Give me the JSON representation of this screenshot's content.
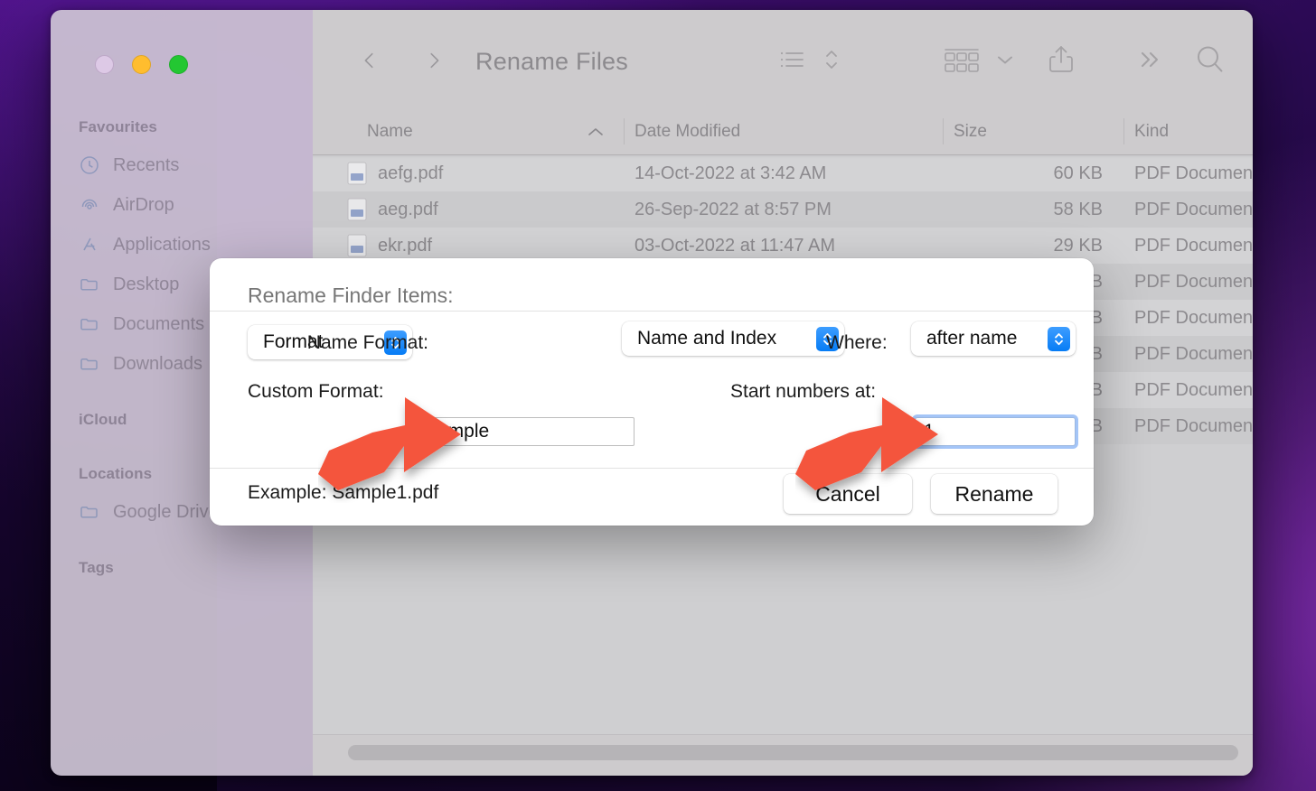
{
  "window": {
    "title": "Rename Files",
    "traffic_lights": [
      "close",
      "minimize",
      "maximize"
    ]
  },
  "toolbar": {
    "back_icon": "chevron-left-icon",
    "forward_icon": "chevron-right-icon",
    "list_view_icon": "list-view-icon",
    "sort_icon": "sort-updown-icon",
    "group_icon": "group-by-icon",
    "group_chevron_icon": "chevron-down-icon",
    "share_icon": "share-icon",
    "more_icon": "more-chevrons-icon",
    "search_icon": "search-icon"
  },
  "sidebar": {
    "sections": [
      {
        "heading": "Favourites",
        "items": [
          {
            "label": "Recents",
            "icon": "clock-icon"
          },
          {
            "label": "AirDrop",
            "icon": "airdrop-icon"
          },
          {
            "label": "Applications",
            "icon": "applications-icon"
          },
          {
            "label": "Desktop",
            "icon": "folder-icon"
          },
          {
            "label": "Documents",
            "icon": "folder-icon"
          },
          {
            "label": "Downloads",
            "icon": "folder-icon"
          }
        ]
      },
      {
        "heading": "iCloud",
        "items": []
      },
      {
        "heading": "Locations",
        "items": [
          {
            "label": "Google Drive",
            "icon": "folder-icon"
          }
        ]
      },
      {
        "heading": "Tags",
        "items": []
      }
    ]
  },
  "filelist": {
    "columns": [
      "Name",
      "Date Modified",
      "Size",
      "Kind"
    ],
    "sort_column": "Name",
    "sort_direction_icon": "chevron-up-icon",
    "rows": [
      {
        "name": "aefg.pdf",
        "date": "14-Oct-2022 at 3:42 AM",
        "size": "60 KB",
        "kind": "PDF Document"
      },
      {
        "name": "aeg.pdf",
        "date": "26-Sep-2022 at 8:57 PM",
        "size": "58 KB",
        "kind": "PDF Document"
      },
      {
        "name": "ekr.pdf",
        "date": "03-Oct-2022 at 11:47 AM",
        "size": "29 KB",
        "kind": "PDF Document"
      },
      {
        "name": "",
        "date": "",
        "size": "KB",
        "kind": "PDF Document"
      },
      {
        "name": "",
        "date": "",
        "size": "KB",
        "kind": "PDF Document"
      },
      {
        "name": "",
        "date": "",
        "size": "KB",
        "kind": "PDF Document"
      },
      {
        "name": "",
        "date": "",
        "size": "KB",
        "kind": "PDF Document"
      },
      {
        "name": "",
        "date": "",
        "size": "KB",
        "kind": "PDF Document"
      }
    ]
  },
  "sheet": {
    "title": "Rename Finder Items:",
    "action_popup": {
      "value": "Format"
    },
    "name_format": {
      "label": "Name Format:",
      "value": "Name and Index"
    },
    "where": {
      "label": "Where:",
      "value": "after name"
    },
    "custom_format": {
      "label": "Custom Format:",
      "value": "Sample"
    },
    "start_numbers": {
      "label": "Start numbers at:",
      "value": "1"
    },
    "example": "Example: Sample1.pdf",
    "cancel_label": "Cancel",
    "rename_label": "Rename"
  },
  "annotations": {
    "arrow_color": "#f4543c",
    "arrows": [
      {
        "name": "arrow-pointing-to-custom-format-field"
      },
      {
        "name": "arrow-pointing-to-start-numbers-field"
      }
    ]
  },
  "colors": {
    "accent_blue": "#067cf5",
    "focus_ring": "#5a96f0",
    "window_chrome": "#cdcbcd",
    "sidebar": "#cdc4d4",
    "arrow_red": "#f4543c"
  }
}
